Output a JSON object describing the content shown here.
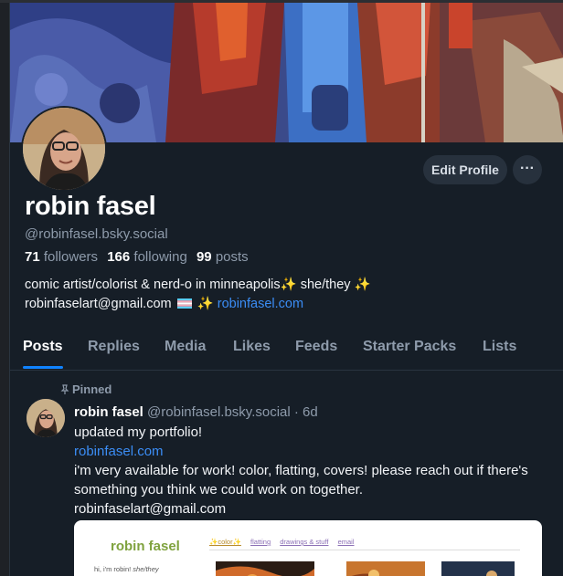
{
  "profile": {
    "display_name": "robin fasel",
    "handle": "@robinfasel.bsky.social",
    "followers_count": "71",
    "followers_label": "followers",
    "following_count": "166",
    "following_label": "following",
    "posts_count": "99",
    "posts_label": "posts",
    "bio_line1": "comic artist/colorist & nerd-o in minneapolis",
    "bio_line1_end": " she/they ",
    "bio_email": "robinfaselart@gmail.com",
    "bio_link": "robinfasel.com",
    "edit_profile_label": "Edit Profile",
    "more_label": "···",
    "sparkle_glyph": "✨"
  },
  "tabs": [
    {
      "label": "Posts"
    },
    {
      "label": "Replies"
    },
    {
      "label": "Media"
    },
    {
      "label": "Likes"
    },
    {
      "label": "Feeds"
    },
    {
      "label": "Starter Packs"
    },
    {
      "label": "Lists"
    }
  ],
  "post": {
    "pinned_label": "Pinned",
    "author_name": "robin fasel",
    "author_handle": "@robinfasel.bsky.social",
    "age": "· 6d",
    "line1": "updated my portfolio!",
    "link": "robinfasel.com",
    "line3": "i'm very available for work! color, flatting, covers! please reach out if there's something you think we could work on together.",
    "line4": "robinfaselart@gmail.com"
  },
  "link_preview": {
    "brand": "robin fasel",
    "nav": [
      "✨color✨",
      "flatting",
      "drawings & stuff",
      "email"
    ],
    "intro_text": "hi, i'm robin!",
    "intro_pronouns": "she/they"
  },
  "colors": {
    "background": "#161e27",
    "accent": "#1083fe",
    "link": "#3b8df5",
    "muted": "#8e9bab"
  },
  "icons": {
    "pin": "pin-icon",
    "more": "more-horizontal-icon"
  }
}
